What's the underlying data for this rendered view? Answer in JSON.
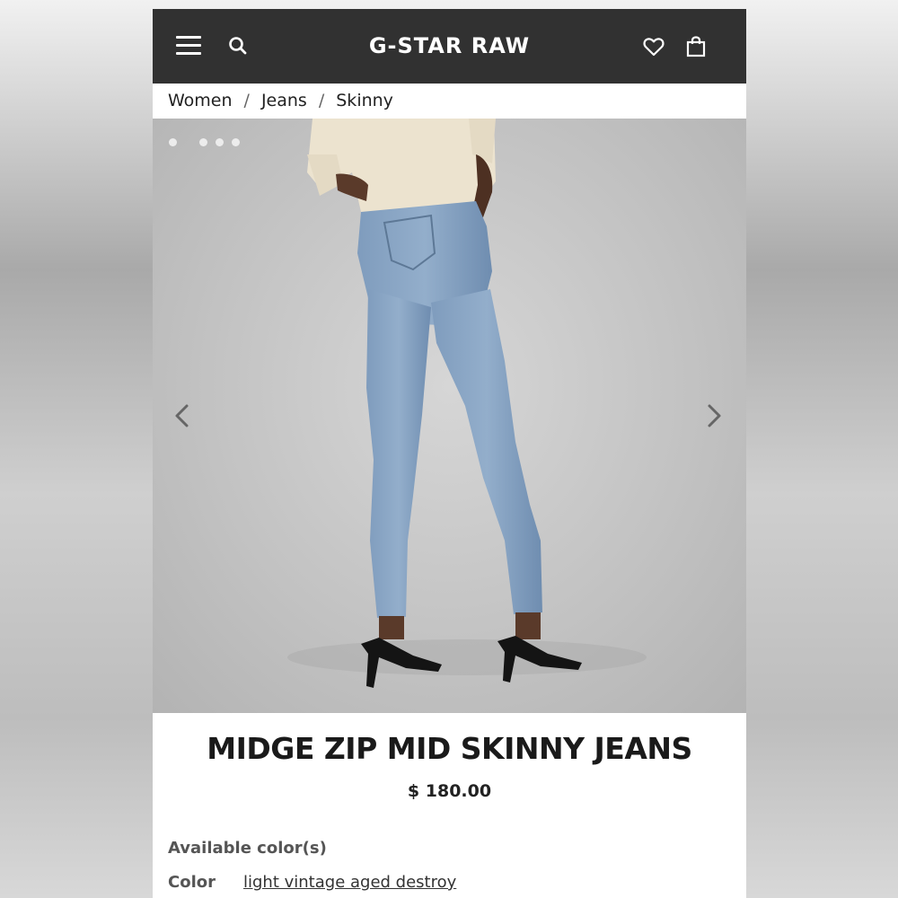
{
  "header": {
    "logo": "G-STAR RAW",
    "icons": [
      "menu-icon",
      "search-icon",
      "heart-icon",
      "bag-icon"
    ],
    "background": "#313131"
  },
  "breadcrumb": [
    "Women",
    "Jeans",
    "Skinny"
  ],
  "gallery": {
    "image_count": 4,
    "icons": [
      "chevron-left-icon",
      "chevron-right-icon"
    ]
  },
  "product": {
    "title": "MIDGE ZIP MID SKINNY JEANS",
    "price": "$ 180.00",
    "available_colors_label": "Available color(s)",
    "color_label": "Color",
    "color_value": "light vintage aged destroy"
  }
}
